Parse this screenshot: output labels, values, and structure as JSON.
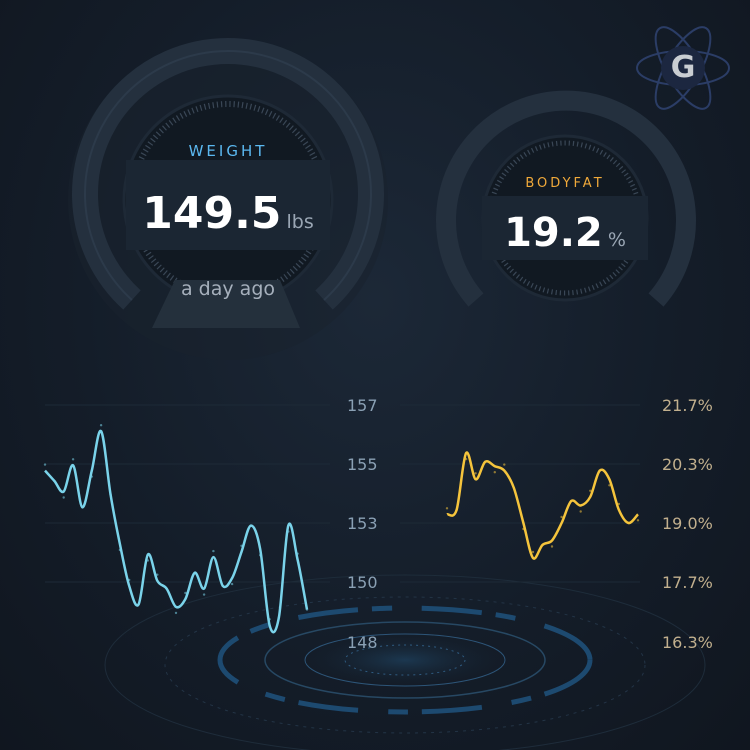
{
  "weight": {
    "label": "WEIGHT",
    "value": "149.5",
    "unit": "lbs",
    "updated": "a day ago",
    "label_color": "#5bb8f0",
    "axis_ticks": [
      "157",
      "155",
      "153",
      "150",
      "148"
    ]
  },
  "bodyfat": {
    "label": "BODYFAT",
    "value": "19.2",
    "unit": "%",
    "label_color": "#f0a93a",
    "axis_ticks": [
      "21.7%",
      "20.3%",
      "19.0%",
      "17.7%",
      "16.3%"
    ]
  },
  "logo": {
    "text": "G",
    "icon": "atom-logo-icon"
  },
  "colors": {
    "weight_line": "#7ad3ea",
    "bodyfat_line": "#f5c43c"
  },
  "chart_data": [
    {
      "type": "line",
      "series": [
        {
          "values": [
            154.5,
            154.1,
            153.7,
            154.7,
            153.1,
            154.5,
            156.0,
            153.6,
            151.7,
            150.1,
            149.4,
            151.3,
            150.3,
            150.0,
            149.3,
            149.6,
            150.6,
            150.0,
            151.2,
            150.1,
            150.4,
            151.4,
            152.4,
            151.5,
            148.6,
            148.9,
            152.4,
            151.1,
            149.2
          ]
        }
      ],
      "ylim": [
        148,
        157
      ],
      "yticks": [
        "157",
        "155",
        "153",
        "150",
        "148"
      ]
    },
    {
      "type": "line",
      "series": [
        {
          "values": [
            19.2,
            19.3,
            20.6,
            20.0,
            20.4,
            20.3,
            20.2,
            19.8,
            19.0,
            18.2,
            18.5,
            18.6,
            19.0,
            19.5,
            19.4,
            19.6,
            20.2,
            20.0,
            19.3,
            19.0,
            19.2
          ]
        }
      ],
      "ylim": [
        16.3,
        21.7
      ],
      "yticks": [
        "21.7%",
        "20.3%",
        "19.0%",
        "17.7%",
        "16.3%"
      ]
    }
  ]
}
